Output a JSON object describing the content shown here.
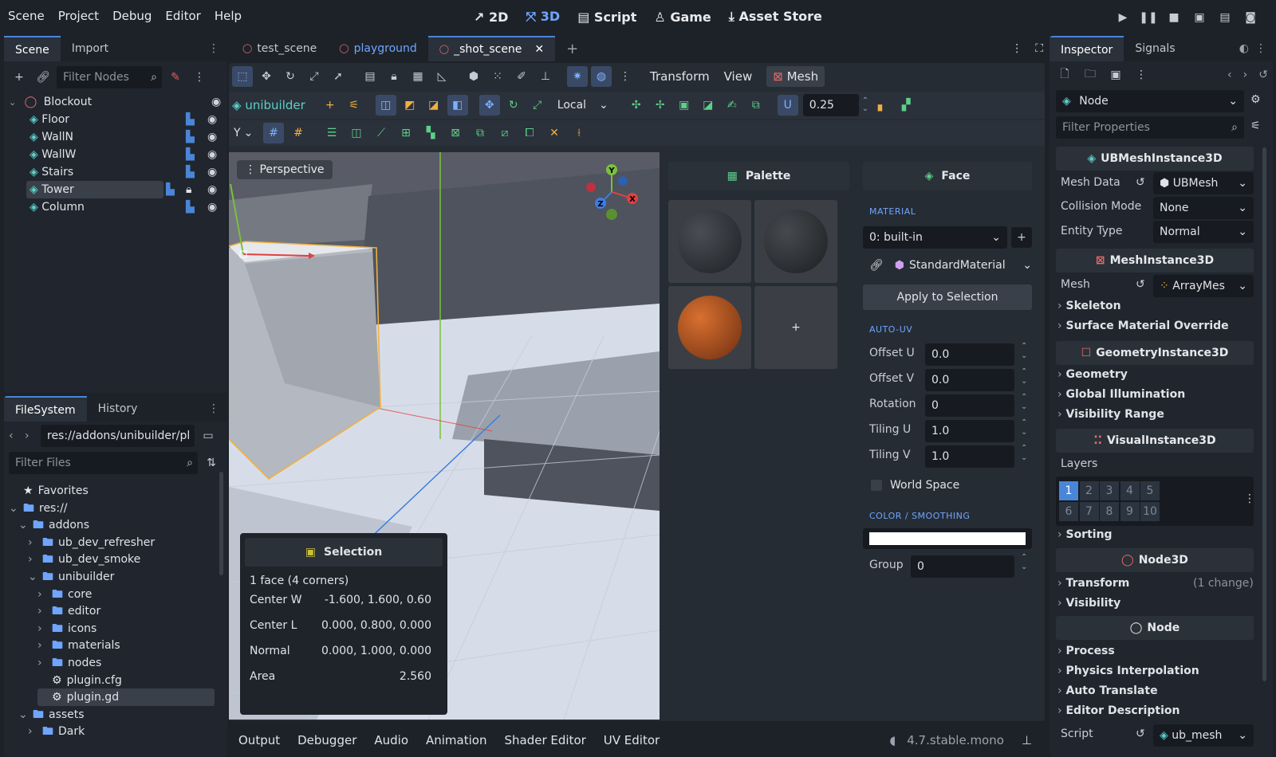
{
  "menu": [
    "Scene",
    "Project",
    "Debug",
    "Editor",
    "Help"
  ],
  "workspaces": [
    {
      "label": "2D",
      "icon": "↗"
    },
    {
      "label": "3D",
      "icon": "⤧"
    },
    {
      "label": "Script",
      "icon": "▤"
    },
    {
      "label": "Game",
      "icon": "♙"
    },
    {
      "label": "Asset Store",
      "icon": "⤓"
    }
  ],
  "scene_dock": {
    "tabs": [
      "Scene",
      "Import"
    ],
    "filter_placeholder": "Filter Nodes",
    "root": "Blockout",
    "nodes": [
      "Floor",
      "WallN",
      "WallW",
      "Stairs",
      "Tower",
      "Column"
    ],
    "selected": "Tower"
  },
  "fs_dock": {
    "tabs": [
      "FileSystem",
      "History"
    ],
    "path": "res://addons/unibuilder/pl",
    "filter_placeholder": "Filter Files",
    "items": [
      {
        "label": "Favorites",
        "depth": 0,
        "icon": "star"
      },
      {
        "label": "res://",
        "depth": 0,
        "icon": "folder"
      },
      {
        "label": "addons",
        "depth": 1,
        "icon": "folder"
      },
      {
        "label": "ub_dev_refresher",
        "depth": 2,
        "icon": "folder"
      },
      {
        "label": "ub_dev_smoke",
        "depth": 2,
        "icon": "folder"
      },
      {
        "label": "unibuilder",
        "depth": 2,
        "icon": "folder"
      },
      {
        "label": "core",
        "depth": 3,
        "icon": "folder"
      },
      {
        "label": "editor",
        "depth": 3,
        "icon": "folder"
      },
      {
        "label": "icons",
        "depth": 3,
        "icon": "folder"
      },
      {
        "label": "materials",
        "depth": 3,
        "icon": "folder"
      },
      {
        "label": "nodes",
        "depth": 3,
        "icon": "folder"
      },
      {
        "label": "plugin.cfg",
        "depth": 3,
        "icon": "gear"
      },
      {
        "label": "plugin.gd",
        "depth": 3,
        "icon": "gear"
      },
      {
        "label": "assets",
        "depth": 1,
        "icon": "folder"
      },
      {
        "label": "Dark",
        "depth": 2,
        "icon": "folder"
      }
    ]
  },
  "scene_tabs": [
    "test_scene",
    "playground",
    "_shot_scene"
  ],
  "toolbar": {
    "transform": "Transform",
    "view": "View",
    "mesh": "Mesh",
    "unibuilder": "unibuilder",
    "local": "Local",
    "snap": "0.25",
    "axis": "Y"
  },
  "viewport": {
    "perspective": "Perspective"
  },
  "selection": {
    "title": "Selection",
    "summary": "1 face (4 corners)",
    "rows": [
      {
        "k": "Center W",
        "v": "-1.600, 1.600, 0.60"
      },
      {
        "k": "Center L",
        "v": "0.000, 0.800, 0.000"
      },
      {
        "k": "Normal",
        "v": "0.000, 1.000, 0.000"
      },
      {
        "k": "Area",
        "v": "2.560"
      }
    ]
  },
  "palette": {
    "title": "Palette",
    "add": "+"
  },
  "face": {
    "title": "Face",
    "material_cap": "MATERIAL",
    "material": "0: built-in",
    "material_type": "StandardMaterial",
    "apply": "Apply to Selection",
    "autouv_cap": "AUTO-UV",
    "uv": [
      {
        "k": "Offset U",
        "v": "0.0"
      },
      {
        "k": "Offset V",
        "v": "0.0"
      },
      {
        "k": "Rotation",
        "v": "0"
      },
      {
        "k": "Tiling U",
        "v": "1.0"
      },
      {
        "k": "Tiling V",
        "v": "1.0"
      }
    ],
    "world_space": "World Space",
    "color_cap": "COLOR / SMOOTHING",
    "group_label": "Group",
    "group": "0",
    "color": "#ffffff"
  },
  "bottom": {
    "tabs": [
      "Output",
      "Debugger",
      "Audio",
      "Animation",
      "Shader Editor",
      "UV Editor"
    ],
    "version": "4.7.stable.mono"
  },
  "inspector": {
    "tabs": [
      "Inspector",
      "Signals"
    ],
    "node": "Node",
    "filter_placeholder": "Filter Properties",
    "ubmesh": "UBMeshInstance3D",
    "mesh_data_label": "Mesh Data",
    "mesh_data": "UBMesh",
    "collision_label": "Collision Mode",
    "collision": "None",
    "entity_label": "Entity Type",
    "entity": "Normal",
    "meshinst": "MeshInstance3D",
    "mesh_label": "Mesh",
    "mesh": "ArrayMes",
    "meshinst_items": [
      "Skeleton",
      "Surface Material Override"
    ],
    "geom": "GeometryInstance3D",
    "geom_items": [
      "Geometry",
      "Global Illumination",
      "Visibility Range"
    ],
    "visual": "VisualInstance3D",
    "layers_label": "Layers",
    "layers": [
      "1",
      "2",
      "3",
      "4",
      "5",
      "6",
      "7",
      "8",
      "9",
      "10"
    ],
    "sorting": "Sorting",
    "node3d": "Node3D",
    "transform": "Transform",
    "transform_note": "(1 change)",
    "visibility": "Visibility",
    "node_items": [
      "Process",
      "Physics Interpolation",
      "Auto Translate",
      "Editor Description"
    ],
    "script_label": "Script",
    "script": "ub_mesh"
  }
}
